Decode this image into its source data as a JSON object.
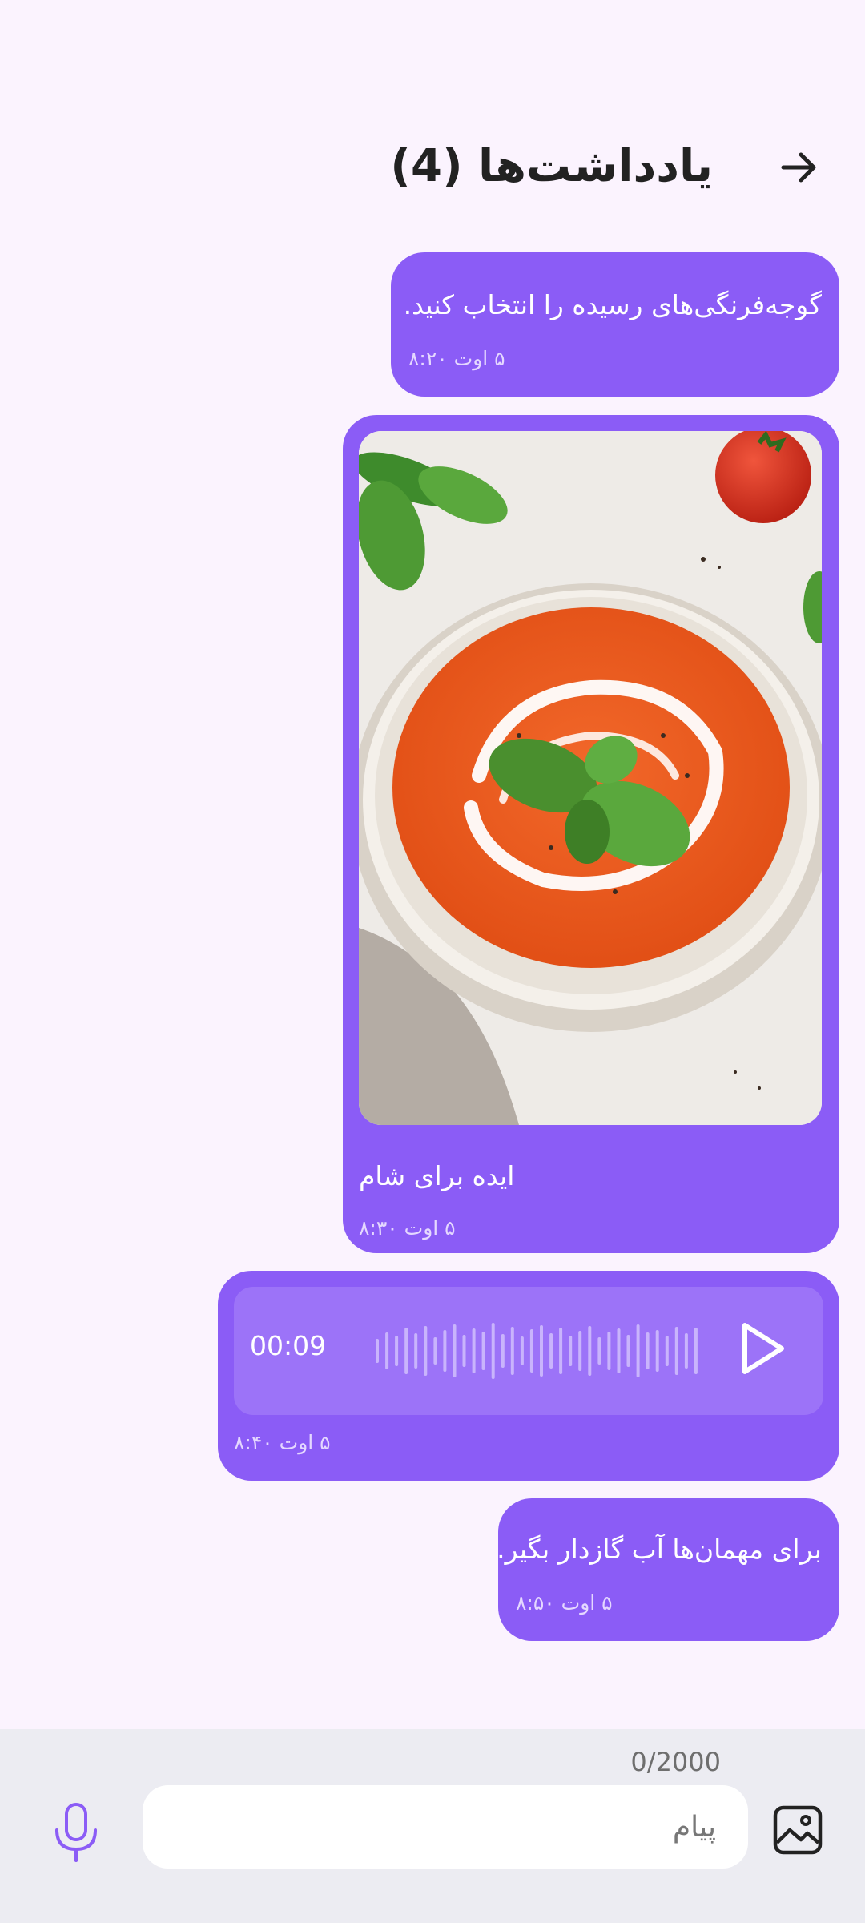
{
  "header": {
    "title": "یادداشت‌ها (4)"
  },
  "messages": [
    {
      "type": "text",
      "text": "گوجه‌فرنگی‌های رسیده را انتخاب کنید.",
      "time": "۵ اوت ۸:۲۰"
    },
    {
      "type": "image",
      "image": "tomato-soup-bowl-with-basil-and-cream",
      "caption": "ایده برای شام",
      "time": "۵ اوت ۸:۳۰"
    },
    {
      "type": "voice",
      "duration": "00:09",
      "time": "۵ اوت ۸:۴۰"
    },
    {
      "type": "text",
      "text": "برای مهمان‌ها آب گازدار بگیر.",
      "time": "۵ اوت ۸:۵۰"
    }
  ],
  "composer": {
    "counter": "0/2000",
    "placeholder": "پیام",
    "value": ""
  },
  "icons": {
    "back": "arrow-right-icon",
    "play": "play-icon",
    "mic": "microphone-icon",
    "gallery": "image-icon"
  },
  "colors": {
    "background": "#FBF3FE",
    "bubble": "#8B5CF6",
    "voice_panel": "#9C73F8",
    "accent": "#8B5CF6",
    "composer_bg": "#ECECF2"
  }
}
